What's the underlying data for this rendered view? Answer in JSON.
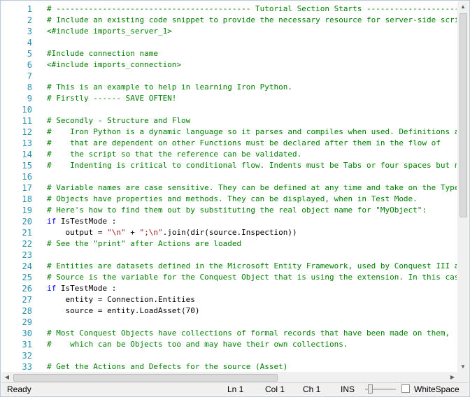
{
  "editor": {
    "line_numbers": [
      "1",
      "2",
      "3",
      "4",
      "5",
      "6",
      "7",
      "8",
      "9",
      "10",
      "11",
      "12",
      "13",
      "14",
      "15",
      "16",
      "17",
      "18",
      "19",
      "20",
      "21",
      "22",
      "23",
      "24",
      "25",
      "26",
      "27",
      "28",
      "29",
      "30",
      "31",
      "32",
      "33"
    ],
    "lines": [
      {
        "text": "# ------------------------------------------ Tutorial Section Starts -----------------------------------------",
        "type": "comment"
      },
      {
        "text": "# Include an existing code snippet to provide the necessary resource for server-side scri",
        "type": "comment"
      },
      {
        "text": "<#include imports_server_1>",
        "type": "comment"
      },
      {
        "text": "",
        "type": "comment"
      },
      {
        "text": "#Include connection name",
        "type": "comment"
      },
      {
        "text": "<#include imports_connection>",
        "type": "comment"
      },
      {
        "text": "",
        "type": "comment"
      },
      {
        "text": "# This is an example to help in learning Iron Python.",
        "type": "comment"
      },
      {
        "text": "# Firstly ------ SAVE OFTEN!",
        "type": "comment"
      },
      {
        "text": "",
        "type": "comment"
      },
      {
        "text": "# Secondly - Structure and Flow",
        "type": "comment"
      },
      {
        "text": "#    Iron Python is a dynamic language so it parses and compiles when used. Definitions a",
        "type": "comment"
      },
      {
        "text": "#    that are dependent on other Functions must be declared after them in the flow of",
        "type": "comment"
      },
      {
        "text": "#    the script so that the reference can be validated.",
        "type": "comment"
      },
      {
        "text": "#    Indenting is critical to conditional flow. Indents must be Tabs or four spaces but n",
        "type": "comment"
      },
      {
        "text": "",
        "type": "comment"
      },
      {
        "text": "# Variable names are case sensitive. They can be defined at any time and take on the Type",
        "type": "comment"
      },
      {
        "text": "# Objects have properties and methods. They can be displayed, when in Test Mode.",
        "type": "comment"
      },
      {
        "text": "# Here's how to find them out by substituting the real object name for \"MyObject\":",
        "type": "comment"
      },
      {
        "kw": "if",
        "text": " IsTestMode :",
        "type": "if"
      },
      {
        "pre": "    output = ",
        "s1": "\"\\n\"",
        "mid": " + ",
        "s2": "\";\\n\"",
        "post": ".join(dir(source.Inspection))",
        "type": "strline"
      },
      {
        "text": "# See the \"print\" after Actions are loaded",
        "type": "comment"
      },
      {
        "text": "",
        "type": "comment"
      },
      {
        "text": "# Entities are datasets defined in the Microsoft Entity Framework, used by Conquest III a",
        "type": "comment"
      },
      {
        "text": "# Source is the variable for the Conquest Object that is using the extension. In this cas",
        "type": "comment"
      },
      {
        "kw": "if",
        "text": " IsTestMode :",
        "type": "if"
      },
      {
        "text": "    entity = Connection.Entities",
        "type": "plain"
      },
      {
        "text": "    source = entity.LoadAsset(70)",
        "type": "plain"
      },
      {
        "text": "",
        "type": "comment"
      },
      {
        "text": "# Most Conquest Objects have collections of formal records that have been made on them,",
        "type": "comment"
      },
      {
        "text": "#    which can be Objects too and may have their own collections.",
        "type": "comment"
      },
      {
        "text": "",
        "type": "comment"
      },
      {
        "text": "# Get the Actions and Defects for the source (Asset)",
        "type": "comment"
      }
    ],
    "vertical_scroll_position": 0.0,
    "horizontal_scroll_position": 0.0
  },
  "status_bar": {
    "state": "Ready",
    "line": "Ln 1",
    "column": "Col 1",
    "character": "Ch 1",
    "insert_mode": "INS",
    "whitespace_label": "WhiteSpace",
    "whitespace_checked": false
  },
  "colors": {
    "comment": "#008000",
    "keyword": "#0000ff",
    "string": "#a31515",
    "line_number": "#2b91af"
  },
  "icons": {
    "scroll_up": "arrow-up-icon",
    "scroll_down": "arrow-down-icon",
    "scroll_left": "arrow-left-icon",
    "scroll_right": "arrow-right-icon"
  }
}
